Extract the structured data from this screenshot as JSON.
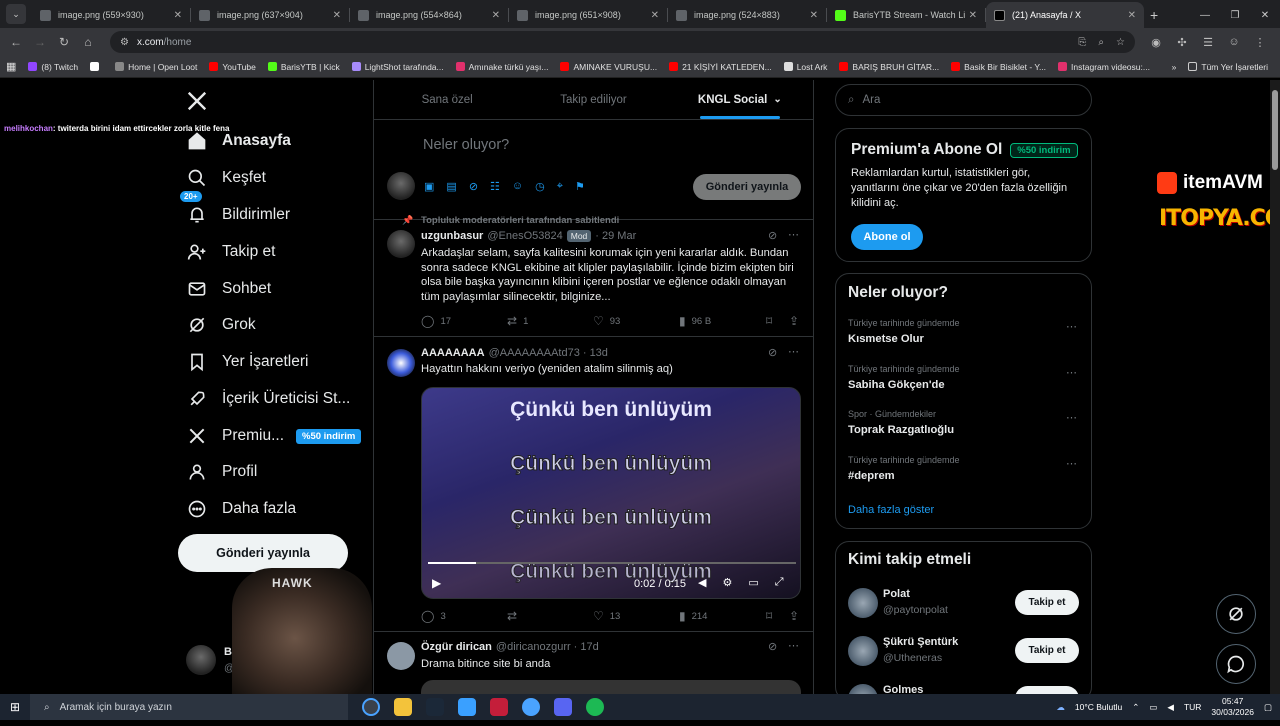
{
  "browser": {
    "tabs": [
      {
        "title": "image.png (559×930)",
        "fav": "#5f6368"
      },
      {
        "title": "image.png (637×904)",
        "fav": "#5f6368"
      },
      {
        "title": "image.png (554×864)",
        "fav": "#5f6368"
      },
      {
        "title": "image.png (651×908)",
        "fav": "#5f6368"
      },
      {
        "title": "image.png (524×883)",
        "fav": "#5f6368"
      },
      {
        "title": "BarisYTB Stream - Watch Live o",
        "fav": "#53fc18"
      },
      {
        "title": "(21) Anasayfa / X",
        "fav": "#000000"
      }
    ],
    "url_host": "x.com",
    "url_path": "/home",
    "bookmarks": [
      {
        "label": "(8) Twitch",
        "color": "#9146ff"
      },
      {
        "label": "",
        "color": "#ffffff"
      },
      {
        "label": "Home | Open Loot",
        "color": "#888888"
      },
      {
        "label": "YouTube",
        "color": "#ff0000"
      },
      {
        "label": "BarisYTB | Kick",
        "color": "#53fc18"
      },
      {
        "label": "LightShot tarafında...",
        "color": "#a78bfa"
      },
      {
        "label": "Amınake türkü yaşı...",
        "color": "#e1306c"
      },
      {
        "label": "AMINAKE VURUŞU...",
        "color": "#ff0000"
      },
      {
        "label": "21 KİŞİYİ KATLEDEN...",
        "color": "#ff0000"
      },
      {
        "label": "Lost Ark",
        "color": "#dddddd"
      },
      {
        "label": "BARIŞ BRUH GİTAR...",
        "color": "#ff0000"
      },
      {
        "label": "Basik Bir Bisiklet - Y...",
        "color": "#ff0000"
      },
      {
        "label": "Instagram videosu:...",
        "color": "#e1306c"
      }
    ],
    "all_bookmarks": "Tüm Yer İşaretleri"
  },
  "overlay": {
    "chat_user": "melihkochan",
    "chat_msg": ": twiterda birini idam ettircekler zorla kitle fena",
    "webcam_text": "HAWK"
  },
  "nav": {
    "items": [
      {
        "label": "Anasayfa",
        "icon": "home-icon",
        "bold": true
      },
      {
        "label": "Keşfet",
        "icon": "search-icon"
      },
      {
        "label": "Bildirimler",
        "icon": "bell-icon",
        "badge": "20+"
      },
      {
        "label": "Takip et",
        "icon": "follow-icon"
      },
      {
        "label": "Sohbet",
        "icon": "mail-icon"
      },
      {
        "label": "Grok",
        "icon": "grok-icon"
      },
      {
        "label": "Yer İşaretleri",
        "icon": "bookmark-icon"
      },
      {
        "label": "İçerik Üreticisi St...",
        "icon": "rocket-icon"
      },
      {
        "label": "Premiu...",
        "icon": "x-logo-icon",
        "badge": "%50 indirim"
      },
      {
        "label": "Profil",
        "icon": "profile-icon"
      },
      {
        "label": "Daha fazla",
        "icon": "more-icon"
      }
    ],
    "post_button": "Gönderi yayınla",
    "account_name": "Bari",
    "account_handle": "@Ba"
  },
  "feed": {
    "tabs": [
      "Sana özel",
      "Takip ediliyor",
      "KNGL Social"
    ],
    "active_tab": 2,
    "composer_placeholder": "Neler oluyor?",
    "composer_post": "Gönderi yayınla",
    "tweets": [
      {
        "pinned": "Topluluk moderatörleri tarafından sabitlendi",
        "name": "uzgunbasur",
        "handle": "@EnesO53824",
        "mod": "Mod",
        "time": "· 29 Mar",
        "text": "Arkadaşlar selam, sayfa kalitesini korumak için yeni kararlar aldık. Bundan sonra sadece KNGL ekibine ait klipler paylaşılabilir. İçinde bizim ekipten biri olsa bile başka yayıncının klibini içeren postlar ve eğlence odaklı olmayan tüm paylaşımlar silinecektir, bilginize...",
        "replies": "17",
        "reposts": "1",
        "likes": "93",
        "views": "96 B"
      },
      {
        "name": "AAAAAAAA",
        "handle": "@AAAAAAAAtd73",
        "time": "· 13d",
        "text": "Hayattın hakkını veriyo (yeniden atalim silinmiş aq)",
        "video_lines": [
          "Çünkü ben ünlüyüm",
          "Çünkü ben ünlüyüm",
          "Çünkü ben ünlüyüm",
          "Çünkü ben ünlüyüm"
        ],
        "video_time": "0:02 / 0:15",
        "video_progress": 0.13,
        "replies": "3",
        "reposts": "",
        "likes": "13",
        "views": "214"
      },
      {
        "name": "Özgür dirican",
        "handle": "@diricanozgurr",
        "time": "· 17d",
        "text": "Drama bitince site bi anda"
      }
    ]
  },
  "right": {
    "search_placeholder": "Ara",
    "premium_title": "Premium'a Abone Ol",
    "premium_badge": "%50 indirim",
    "premium_text": "Reklamlardan kurtul, istatistikleri gör, yanıtlarını öne çıkar ve 20'den fazla özelliğin kilidini aç.",
    "premium_button": "Abone ol",
    "trends_title": "Neler oluyor?",
    "trends": [
      {
        "meta": "Türkiye tarihinde gündemde",
        "name": "Kısmetse Olur"
      },
      {
        "meta": "Türkiye tarihinde gündemde",
        "name": "Sabiha Gökçen'de"
      },
      {
        "meta": "Spor · Gündemdekiler",
        "name": "Toprak Razgatlıoğlu"
      },
      {
        "meta": "Türkiye tarihinde gündemde",
        "name": "#deprem"
      }
    ],
    "show_more": "Daha fazla göster",
    "follow_title": "Kimi takip etmeli",
    "follows": [
      {
        "name": "Polat",
        "handle": "@paytonpolat",
        "button": "Takip et"
      },
      {
        "name": "Şükrü Şentürk",
        "handle": "@Utheneras",
        "button": "Takip et"
      },
      {
        "name": "Golmes",
        "handle": "",
        "button": ""
      }
    ]
  },
  "ads": {
    "itemavm": "itemAVM",
    "itopya": "ITOPYA.COM"
  },
  "taskbar": {
    "search": "Aramak için buraya yazın",
    "weather": "10°C  Bulutlu",
    "lang": "TUR",
    "time": "05:47",
    "date": "30/03/2026"
  },
  "colors": {
    "accent": "#1d9bf0",
    "bg": "#000000",
    "border": "#2f3336",
    "muted": "#71767b"
  }
}
